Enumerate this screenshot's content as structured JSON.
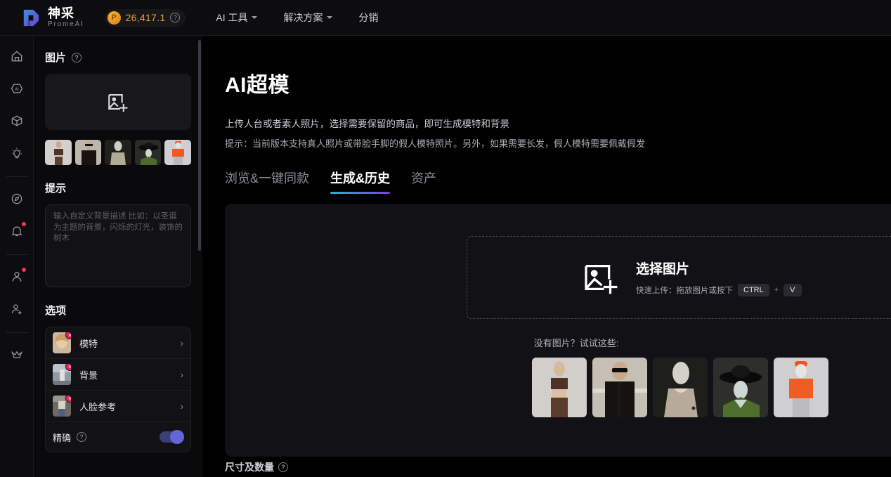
{
  "topbar": {
    "logo_cn": "神采",
    "logo_en": "PromeAI",
    "credits_value": "26,417.1",
    "credits_help": "?",
    "nav": [
      {
        "label": "AI 工具",
        "has_caret": true
      },
      {
        "label": "解决方案",
        "has_caret": true
      },
      {
        "label": "分销",
        "has_caret": false
      }
    ]
  },
  "rail": {
    "items": [
      {
        "name": "home-icon",
        "badge": false
      },
      {
        "name": "ai-hexagon-icon",
        "badge": false
      },
      {
        "name": "cube-3d-icon",
        "badge": false
      },
      {
        "name": "lightbulb-icon",
        "badge": false
      },
      {
        "name": "compass-icon",
        "badge": false
      },
      {
        "name": "bell-icon",
        "badge": true
      },
      {
        "name": "user-icon",
        "badge": true
      },
      {
        "name": "add-user-icon",
        "badge": false
      },
      {
        "name": "crown-icon",
        "badge": false
      }
    ]
  },
  "panel": {
    "image_section_title": "图片",
    "image_help": "?",
    "upload_placeholder_icon": "image-add-icon",
    "thumbnails": [
      {
        "alt": "model-brown-top"
      },
      {
        "alt": "man-sunglasses-black-shirt"
      },
      {
        "alt": "mannequin-beige-coat"
      },
      {
        "alt": "mannequin-black-hat-green"
      },
      {
        "alt": "model-orange-sweater"
      }
    ],
    "prompt_section_title": "提示",
    "prompt_value": "",
    "prompt_placeholder": "输入自定义背景描述\n比如：以圣诞为主题的背景，闪烁的灯光，装饰的树木",
    "options_section_title": "选项",
    "options": [
      {
        "label": "模特",
        "thumb": "model-face",
        "remove": "×",
        "chevron": "›"
      },
      {
        "label": "背景",
        "thumb": "background-street",
        "remove": "×",
        "chevron": "›"
      },
      {
        "label": "人脸参考",
        "thumb": "face-reference",
        "remove": "×",
        "chevron": "›"
      }
    ],
    "precise_label": "精确",
    "precise_help": "?",
    "precise_on": true
  },
  "main": {
    "page_title": "AI超模",
    "subtitle_1": "上传人台或者素人照片，选择需要保留的商品，即可生成模特和背景",
    "subtitle_2": "提示：当前版本支持真人照片或带脸手脚的假人模特照片。另外，如果需要长发，假人模特需要佩戴假发",
    "tabs": [
      {
        "label": "浏览&一键同款",
        "active": false
      },
      {
        "label": "生成&历史",
        "active": true
      },
      {
        "label": "资产",
        "active": false
      }
    ],
    "upload": {
      "icon": "image-add-large-icon",
      "title": "选择图片",
      "hint_prefix": "快速上传：拖放图片或按下",
      "key_ctrl": "CTRL",
      "key_plus": "+",
      "key_v": "V"
    },
    "samples_label": "没有图片？试试这些:",
    "samples": [
      {
        "alt": "model-brown-sports-bra"
      },
      {
        "alt": "man-sunglasses-black-shirt"
      },
      {
        "alt": "mannequin-beige-trench"
      },
      {
        "alt": "mannequin-black-wide-hat"
      },
      {
        "alt": "model-orange-sweater-cap"
      }
    ],
    "bottom_hint": "尺寸及数量",
    "bottom_help": "?"
  },
  "colors": {
    "accent_start": "#2ab0d0",
    "accent_end": "#7b3fe4",
    "credit_orange": "#e3a13c",
    "badge_red": "#ff2d55",
    "toggle_on": "#6366d8"
  }
}
